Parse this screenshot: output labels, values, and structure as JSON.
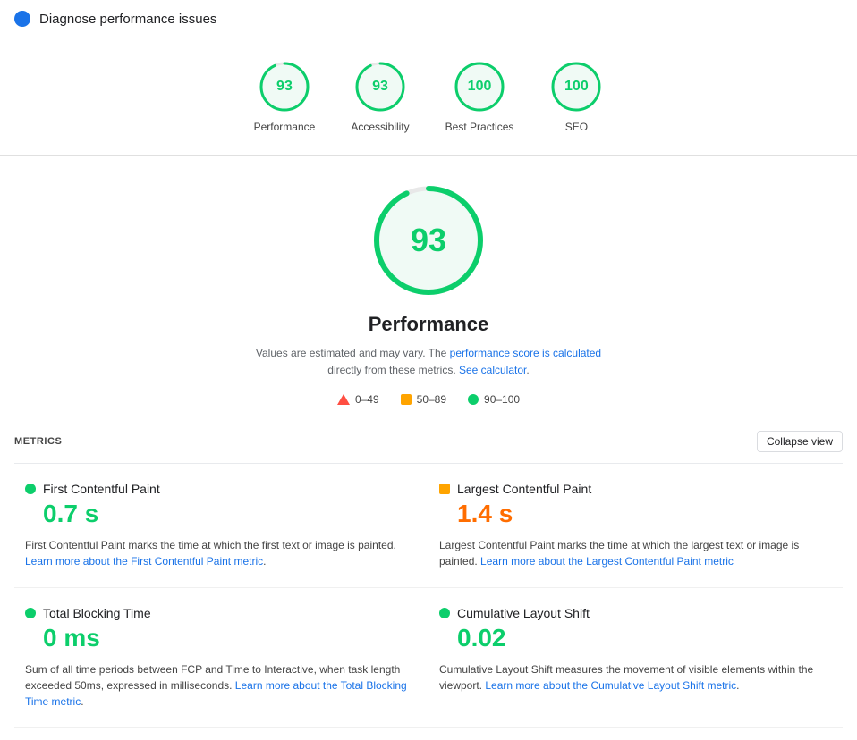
{
  "header": {
    "title": "Diagnose performance issues"
  },
  "scores": [
    {
      "id": "performance",
      "value": 93,
      "label": "Performance",
      "color": "#0cce6b",
      "radius": 26,
      "circumference": 163.4,
      "dashoffset": 11.4,
      "type": "green"
    },
    {
      "id": "accessibility",
      "value": 93,
      "label": "Accessibility",
      "color": "#0cce6b",
      "radius": 26,
      "circumference": 163.4,
      "dashoffset": 11.4,
      "type": "green"
    },
    {
      "id": "best-practices",
      "value": 100,
      "label": "Best Practices",
      "color": "#0cce6b",
      "radius": 26,
      "circumference": 163.4,
      "dashoffset": 0,
      "type": "green"
    },
    {
      "id": "seo",
      "value": 100,
      "label": "SEO",
      "color": "#0cce6b",
      "radius": 26,
      "circumference": 163.4,
      "dashoffset": 0,
      "type": "green"
    }
  ],
  "main": {
    "score": 93,
    "title": "Performance",
    "disclaimer_text": "Values are estimated and may vary. The ",
    "disclaimer_link1_text": "performance score is calculated",
    "disclaimer_link1_href": "#",
    "disclaimer_mid": " directly from these metrics. ",
    "disclaimer_link2_text": "See calculator",
    "disclaimer_link2_href": "#",
    "disclaimer_end": "."
  },
  "legend": [
    {
      "id": "red",
      "range": "0–49",
      "type": "red"
    },
    {
      "id": "orange",
      "range": "50–89",
      "type": "orange"
    },
    {
      "id": "green",
      "range": "90–100",
      "type": "green"
    }
  ],
  "metrics_label": "METRICS",
  "collapse_label": "Collapse view",
  "metrics": [
    {
      "id": "fcp",
      "name": "First Contentful Paint",
      "value": "0.7 s",
      "color_class": "green",
      "dot_type": "green",
      "description": "First Contentful Paint marks the time at which the first text or image is painted.",
      "link_text": "Learn more about the First Contentful Paint metric",
      "link_href": "#"
    },
    {
      "id": "lcp",
      "name": "Largest Contentful Paint",
      "value": "1.4 s",
      "color_class": "orange",
      "dot_type": "orange",
      "description": "Largest Contentful Paint marks the time at which the largest text or image is painted.",
      "link_text": "Learn more about the Largest Contentful Paint metric",
      "link_href": "#"
    },
    {
      "id": "tbt",
      "name": "Total Blocking Time",
      "value": "0 ms",
      "color_class": "green",
      "dot_type": "green",
      "description": "Sum of all time periods between FCP and Time to Interactive, when task length exceeded 50ms, expressed in milliseconds.",
      "link_text": "Learn more about the Total Blocking Time metric",
      "link_href": "#"
    },
    {
      "id": "cls",
      "name": "Cumulative Layout Shift",
      "value": "0.02",
      "color_class": "green",
      "dot_type": "green",
      "description": "Cumulative Layout Shift measures the movement of visible elements within the viewport.",
      "link_text": "Learn more about the Cumulative Layout Shift metric",
      "link_href": "#"
    }
  ]
}
